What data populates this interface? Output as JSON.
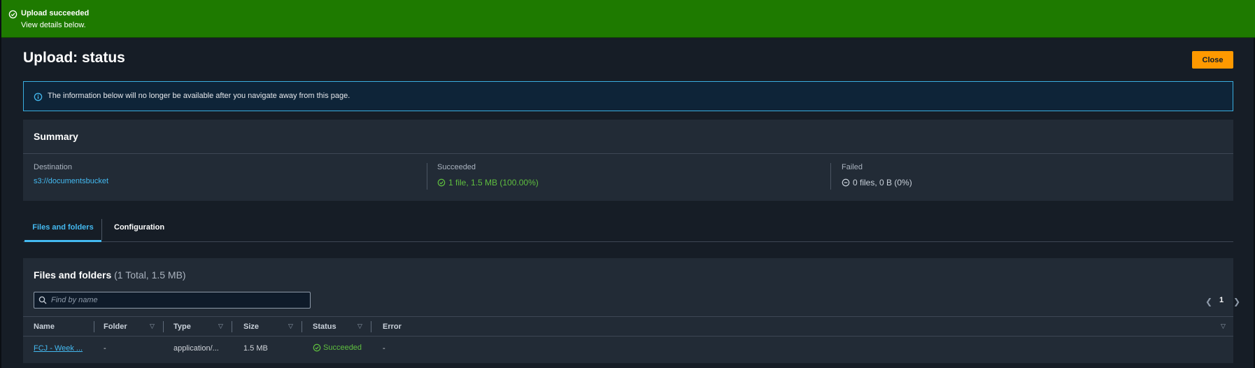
{
  "flash": {
    "title": "Upload succeeded",
    "subtitle": "View details below.",
    "color": "#1e7a00"
  },
  "page": {
    "title": "Upload: status",
    "close_label": "Close"
  },
  "info_alert": {
    "text": "The information below will no longer be available after you navigate away from this page."
  },
  "summary": {
    "title": "Summary",
    "destination_label": "Destination",
    "destination_value": "s3://documentsbucket",
    "succeeded_label": "Succeeded",
    "succeeded_value": "1 file, 1.5 MB (100.00%)",
    "failed_label": "Failed",
    "failed_value": "0 files, 0 B (0%)"
  },
  "tabs": [
    {
      "label": "Files and folders",
      "active": true
    },
    {
      "label": "Configuration",
      "active": false
    }
  ],
  "files": {
    "title": "Files and folders",
    "count": "(1 Total, 1.5 MB)",
    "search_placeholder": "Find by name",
    "page": "1",
    "columns": [
      "Name",
      "Folder",
      "Type",
      "Size",
      "Status",
      "Error"
    ],
    "rows": [
      {
        "name": "FCJ - Week ...",
        "folder": "-",
        "type": "application/...",
        "size": "1.5 MB",
        "status": "Succeeded",
        "error": "-"
      }
    ]
  },
  "colors": {
    "accent": "#44b9f0",
    "success": "#5fbf3f",
    "primary_button": "#ff9900",
    "background": "#161d26",
    "panel": "#222b36"
  }
}
